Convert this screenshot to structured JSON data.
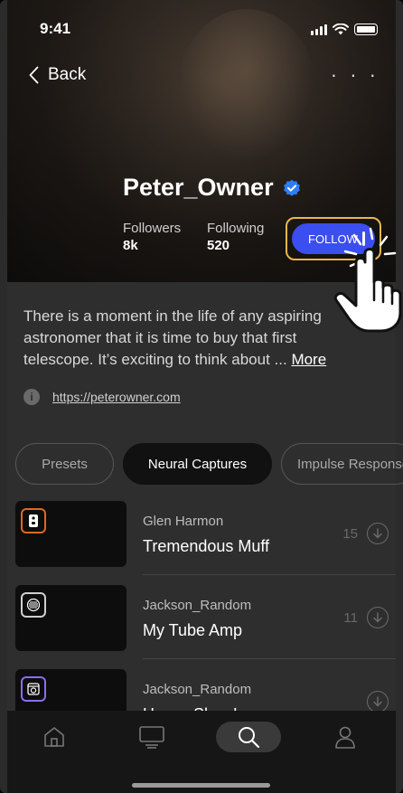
{
  "status": {
    "time": "9:41"
  },
  "nav": {
    "back_label": "Back",
    "more_label": "· · ·"
  },
  "profile": {
    "name": "Peter_Owner",
    "followers_label": "Followers",
    "followers_value": "8k",
    "following_label": "Following",
    "following_value": "520",
    "follow_label": "FOLLOW",
    "bio": "There is a moment in the life of any aspiring astronomer that it is time to buy that first telescope. It’s exciting to think about ...",
    "more_link": "More",
    "website": "https://peterowner.com"
  },
  "tabs": [
    {
      "label": "Presets"
    },
    {
      "label": "Neural Captures"
    },
    {
      "label": "Impulse Responses"
    }
  ],
  "items": [
    {
      "author": "Glen Harmon",
      "title": "Tremendous Muff",
      "count": "15",
      "badge_color": "#e0671f",
      "icon": "pedal-icon"
    },
    {
      "author": "Jackson_Random",
      "title": "My Tube Amp",
      "count": "11",
      "badge_color": "#cfcfcf",
      "icon": "amp-icon"
    },
    {
      "author": "Jackson_Random",
      "title": "Heavy Slow Low",
      "count": "",
      "badge_color": "#8a6cf0",
      "icon": "cab-icon"
    }
  ],
  "colors": {
    "accent": "#3b4ef0",
    "highlight": "#e8b84a",
    "verified": "#2f7df6"
  },
  "tabbar": [
    "home-icon",
    "monitor-icon",
    "search-icon",
    "profile-icon"
  ]
}
